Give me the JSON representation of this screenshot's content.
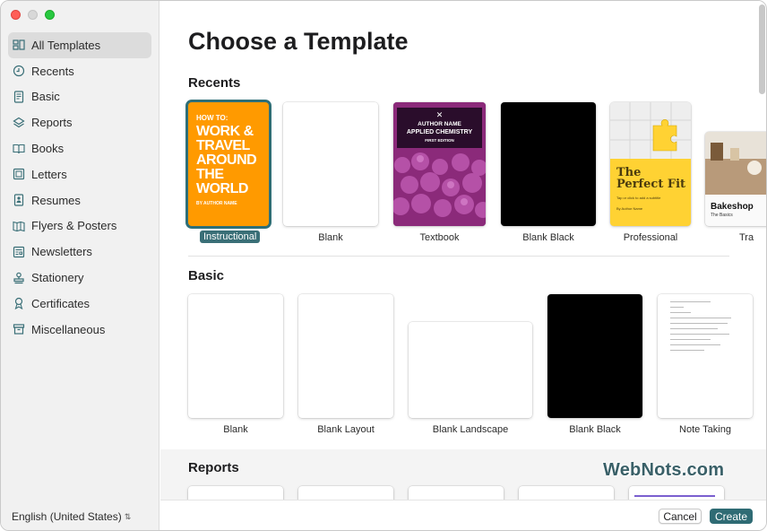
{
  "window": {
    "traffic_lights": [
      "close",
      "minimize",
      "zoom"
    ]
  },
  "sidebar": {
    "items": [
      {
        "label": "All Templates",
        "icon": "all-templates-icon",
        "active": true
      },
      {
        "label": "Recents",
        "icon": "clock-icon"
      },
      {
        "label": "Basic",
        "icon": "document-icon"
      },
      {
        "label": "Reports",
        "icon": "reports-icon"
      },
      {
        "label": "Books",
        "icon": "book-icon"
      },
      {
        "label": "Letters",
        "icon": "letter-icon"
      },
      {
        "label": "Resumes",
        "icon": "resume-icon"
      },
      {
        "label": "Flyers & Posters",
        "icon": "flyer-icon"
      },
      {
        "label": "Newsletters",
        "icon": "newsletter-icon"
      },
      {
        "label": "Stationery",
        "icon": "stamp-icon"
      },
      {
        "label": "Certificates",
        "icon": "ribbon-icon"
      },
      {
        "label": "Miscellaneous",
        "icon": "box-icon"
      }
    ],
    "language": "English (United States)"
  },
  "main": {
    "title": "Choose a Template",
    "sections": {
      "recents": {
        "title": "Recents",
        "templates": [
          "Instructional",
          "Blank",
          "Textbook",
          "Blank Black",
          "Professional",
          "Tra"
        ]
      },
      "basic": {
        "title": "Basic",
        "templates": [
          "Blank",
          "Blank Layout",
          "Blank Landscape",
          "Blank Black",
          "Note Taking"
        ]
      },
      "reports": {
        "title": "Reports"
      }
    },
    "covers": {
      "instructional": {
        "howto": "HOW TO:",
        "headline": "WORK & TRAVEL AROUND THE WORLD",
        "author": "BY AUTHOR NAME"
      },
      "textbook": {
        "mark": "✕",
        "line1": "AUTHOR NAME",
        "line2": "APPLIED CHEMISTRY",
        "line3": "FIRST EDITION"
      },
      "professional": {
        "title": "The Perfect Fit",
        "subtitle": "Tap or click to add a subtitle",
        "author": "By Author Name"
      },
      "bakeshop": {
        "title": "Bakeshop",
        "subtitle": "The Basics"
      }
    }
  },
  "footer": {
    "cancel": "Cancel",
    "create": "Create"
  },
  "watermark": "WebNots.com",
  "colors": {
    "accent": "#2f6b74",
    "sidebar_bg": "#f1f1f1",
    "instructional": "#ff9a00",
    "professional_yellow": "#ffd233"
  }
}
